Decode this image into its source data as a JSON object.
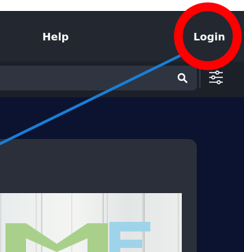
{
  "nav": {
    "help_label": "Help",
    "login_label": "Login"
  },
  "search": {
    "value": "",
    "placeholder": ""
  },
  "icons": {
    "search": "search-icon",
    "filter": "filter-sliders-icon"
  },
  "colors": {
    "topbar": "#23272f",
    "main_background": "#0b1330",
    "card": "#2b2f3a",
    "annotation_circle": "#ff0000",
    "annotation_arrow": "#1a7fd6"
  }
}
